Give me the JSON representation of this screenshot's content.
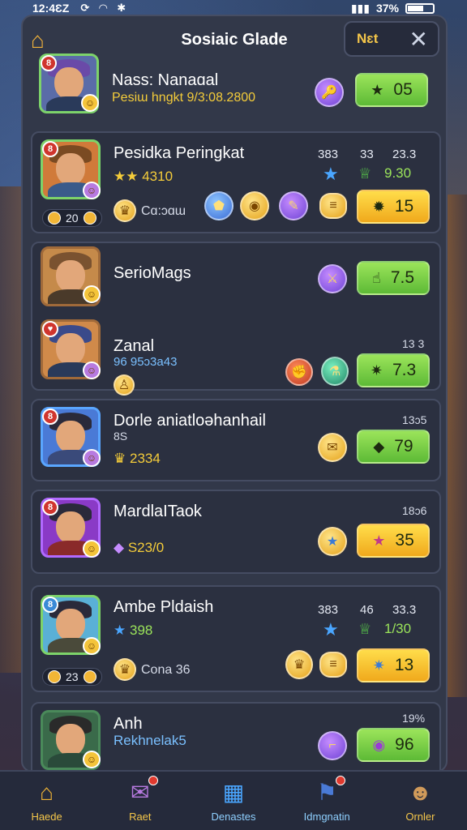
{
  "status_bar": {
    "time": "12:4ƐZ",
    "battery": "37%"
  },
  "header": {
    "title": "Sosiaic Glade",
    "next_label": "Nɛt"
  },
  "entries": [
    {
      "name": "Nass: Nanaɑal",
      "subtitle": "Pesiɯ hngkt 9/3:08.2800",
      "score": "05",
      "color": "green"
    },
    {
      "name": "Pesidka Peringkat",
      "subtitle": "4310",
      "rank": "8",
      "pill": "20",
      "label": "Cɑ:ɔɑɯ",
      "stats_top": [
        "383",
        "33",
        "23.3"
      ],
      "stats_bottom": "9.30",
      "score": "15",
      "color": "gold"
    },
    {
      "name": "SerioMags",
      "score": "7.5",
      "color": "green"
    },
    {
      "name": "Zanal",
      "subtitle": "96  95ɔ3a43",
      "stat": "13 3",
      "score": "7.3",
      "color": "green"
    },
    {
      "name": "Dorle aniatloəhanhail",
      "subtitle": "2334",
      "stat": "13ɔ5",
      "note": "8S",
      "score": "79",
      "color": "green"
    },
    {
      "name": "MardlaITaok",
      "subtitle": "S23/0",
      "stat": "18ɔ6",
      "score": "35",
      "color": "gold"
    },
    {
      "name": "Ambe Pldaish",
      "subtitle": "398",
      "pill": "23",
      "label": "Cona 36",
      "stats_top": [
        "383",
        "46",
        "33.3"
      ],
      "stats_bottom": "1/30",
      "score": "13",
      "color": "gold"
    },
    {
      "name": "Anh",
      "subtitle": "Rekhnelak5",
      "stat": "19%",
      "score": "96",
      "color": "green"
    }
  ],
  "nav": [
    {
      "label": "Haede"
    },
    {
      "label": "Raet"
    },
    {
      "label": "Denastes"
    },
    {
      "label": "Idmgnatin"
    },
    {
      "label": "Ornler"
    }
  ]
}
